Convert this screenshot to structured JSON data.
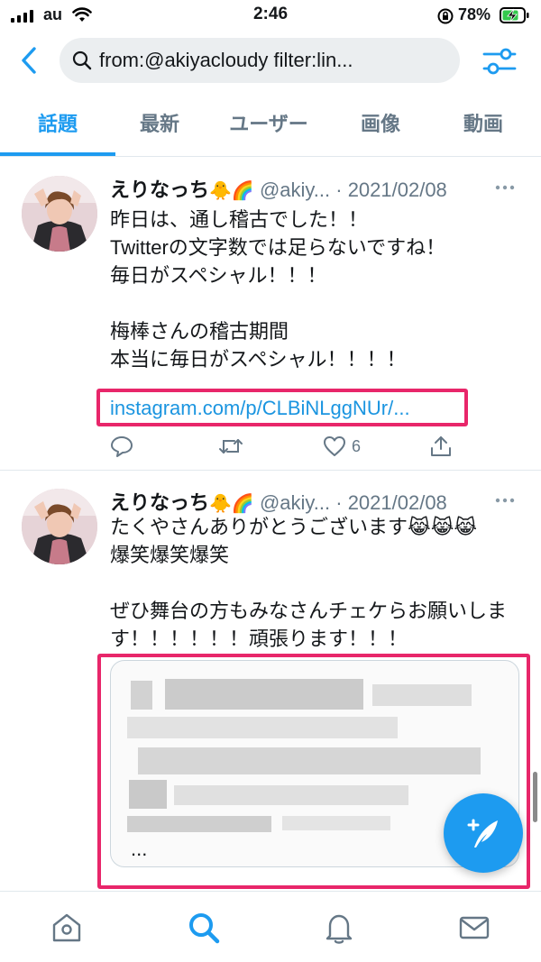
{
  "status_bar": {
    "carrier": "au",
    "time": "2:46",
    "battery": "78%"
  },
  "search": {
    "query": "from:@akiyacloudy filter:lin..."
  },
  "tabs": [
    {
      "label": "話題",
      "active": true
    },
    {
      "label": "最新",
      "active": false
    },
    {
      "label": "ユーザー",
      "active": false
    },
    {
      "label": "画像",
      "active": false
    },
    {
      "label": "動画",
      "active": false
    }
  ],
  "tweets": [
    {
      "name": "えりなっち",
      "name_emoji": "🐥🌈",
      "handle": "@akiy...",
      "date": "2021/02/08",
      "lines": [
        "昨日は、通し稽古でした！！",
        "Twitterの文字数では足らないですね！",
        "毎日がスペシャル！！！",
        "",
        "梅棒さんの稽古期間",
        "本当に毎日がスペシャル！！！！"
      ],
      "link": "instagram.com/p/CLBiNLggNUr/...",
      "like_count": "6"
    },
    {
      "name": "えりなっち",
      "name_emoji": "🐥🌈",
      "handle": "@akiy...",
      "date": "2021/02/08",
      "lines": [
        "たくやさんありがとうございます😹😹😹",
        "爆笑爆笑爆笑",
        "",
        "ぜひ舞台の方もみなさんチェケらお願いしま",
        "す！！！！！！頑張ります！！！"
      ],
      "card_ellipsis": "..."
    }
  ],
  "colors": {
    "accent": "#1d9bf0",
    "highlight": "#e8266a",
    "secondary_text": "#657786"
  },
  "icons": {
    "back": "chevron-left-icon",
    "search": "search-icon",
    "filter": "sliders-icon",
    "reply": "reply-icon",
    "retweet": "retweet-icon",
    "like": "heart-icon",
    "share": "share-icon",
    "compose": "compose-icon",
    "home": "home-icon",
    "explore": "search-icon",
    "notifications": "bell-icon",
    "messages": "mail-icon"
  }
}
